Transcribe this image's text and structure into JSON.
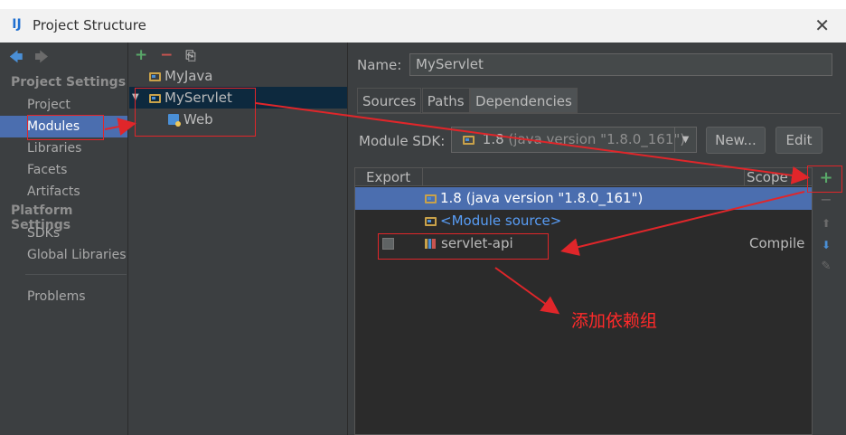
{
  "window": {
    "title": "Project Structure",
    "close_glyph": "✕"
  },
  "nav": {
    "back_glyph": "🡄",
    "forward_glyph": "🡆",
    "project_settings_heading": "Project Settings",
    "project_settings_items": [
      "Project",
      "Modules",
      "Libraries",
      "Facets",
      "Artifacts"
    ],
    "platform_settings_heading": "Platform Settings",
    "platform_settings_items": [
      "SDKs",
      "Global Libraries"
    ],
    "problems": "Problems",
    "selected": "Modules"
  },
  "tree": {
    "add_glyph": "+",
    "remove_glyph": "−",
    "copy_glyph": "⎘",
    "nodes": [
      {
        "label": "MyJava"
      },
      {
        "label": "MyServlet",
        "expanded": true,
        "selected": true
      },
      {
        "label": "Web"
      }
    ],
    "expand_glyph": "▼"
  },
  "detail": {
    "name_label": "Name:",
    "name_value": "MyServlet",
    "tabs": [
      "Sources",
      "Paths",
      "Dependencies"
    ],
    "active_tab": "Dependencies",
    "sdk_label": "Module SDK:",
    "sdk_name": "1.8",
    "sdk_detail": "(java version \"1.8.0_161\")",
    "sdk_drop_glyph": "▼",
    "new_button": "New...",
    "edit_button": "Edit",
    "table": {
      "col_export": "Export",
      "col_scope": "Scope",
      "rows": [
        {
          "text": "1.8 (java version \"1.8.0_161\")",
          "selected": true
        },
        {
          "text": "<Module source>"
        },
        {
          "text": "servlet-api",
          "scope": "Compile",
          "has_checkbox": true
        }
      ]
    },
    "side_buttons": {
      "add": "+",
      "remove": "−",
      "up": "⬆",
      "down": "⬇",
      "edit": "✎"
    }
  },
  "annotation": {
    "text": "添加依赖组",
    "color": "#e0262a"
  }
}
